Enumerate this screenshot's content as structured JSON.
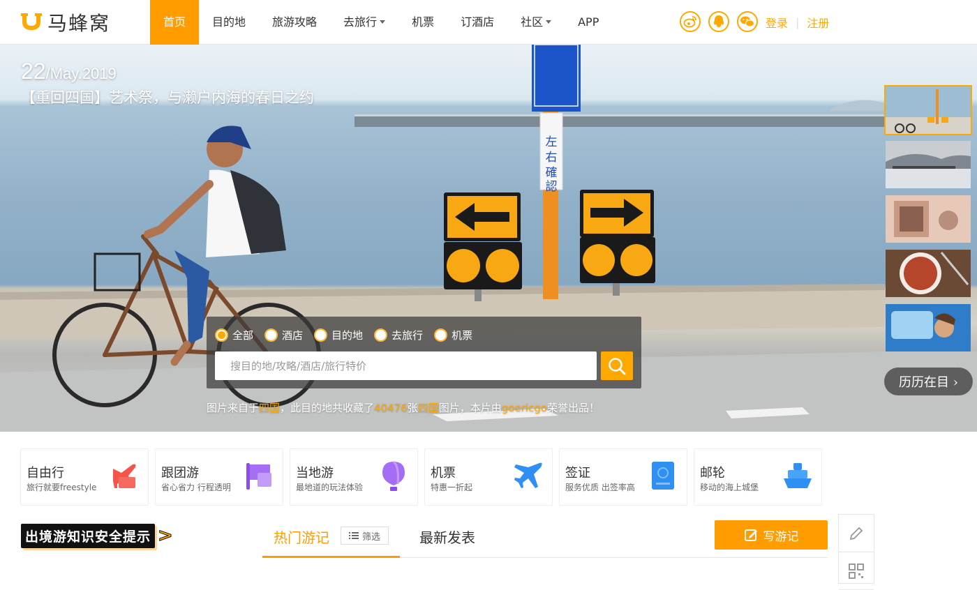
{
  "brand": {
    "name": "马蜂窝"
  },
  "nav": {
    "items": [
      {
        "label": "首页",
        "active": true
      },
      {
        "label": "目的地"
      },
      {
        "label": "旅游攻略"
      },
      {
        "label": "去旅行",
        "dropdown": true
      },
      {
        "label": "机票"
      },
      {
        "label": "订酒店"
      },
      {
        "label": "社区",
        "dropdown": true
      },
      {
        "label": "APP"
      }
    ]
  },
  "social": [
    "weibo-icon",
    "qq-icon",
    "wechat-icon"
  ],
  "auth": {
    "login": "登录",
    "register": "注册"
  },
  "hero": {
    "day": "22",
    "month_year": "/May.2019",
    "title": "【重回四国】艺术祭，与濑户内海的春日之约",
    "history_label": "历历在目 ›"
  },
  "search": {
    "options": [
      {
        "label": "全部",
        "selected": true
      },
      {
        "label": "酒店"
      },
      {
        "label": "目的地"
      },
      {
        "label": "去旅行"
      },
      {
        "label": "机票"
      }
    ],
    "placeholder": "搜目的地/攻略/酒店/旅行特价"
  },
  "credit": {
    "p1": "图片来自于",
    "place": "四国",
    "p2": "，此目的地共收藏了",
    "count": "40476",
    "p3": "张",
    "place2": "四国",
    "p4": "图片，本片由",
    "author": "goericgo",
    "p5": "荣誉出品！"
  },
  "services": [
    {
      "title": "自由行",
      "subtitle": "旅行就要freestyle",
      "icon": "plane-tag-icon",
      "color": "#f4544a"
    },
    {
      "title": "跟团游",
      "subtitle": "省心省力 行程透明",
      "icon": "flag-icon",
      "color": "#9b59f0"
    },
    {
      "title": "当地游",
      "subtitle": "最地道的玩法体验",
      "icon": "balloon-icon",
      "color": "#a56df5"
    },
    {
      "title": "机票",
      "subtitle": "特惠一折起",
      "icon": "airplane-icon",
      "color": "#2f8ff2"
    },
    {
      "title": "签证",
      "subtitle": "服务优质 出签率高",
      "icon": "passport-icon",
      "color": "#2f8ff2"
    },
    {
      "title": "邮轮",
      "subtitle": "移动的海上城堡",
      "icon": "cruise-ship-icon",
      "color": "#2f8ff2"
    }
  ],
  "notice": {
    "label": "出境游知识安全提示",
    "arrow": ">"
  },
  "tabs": {
    "hot": "热门游记",
    "filter": "筛选",
    "latest": "最新发表",
    "write": "写游记"
  },
  "colors": {
    "accent": "#ff9d00",
    "accent_light": "#ffa800"
  }
}
